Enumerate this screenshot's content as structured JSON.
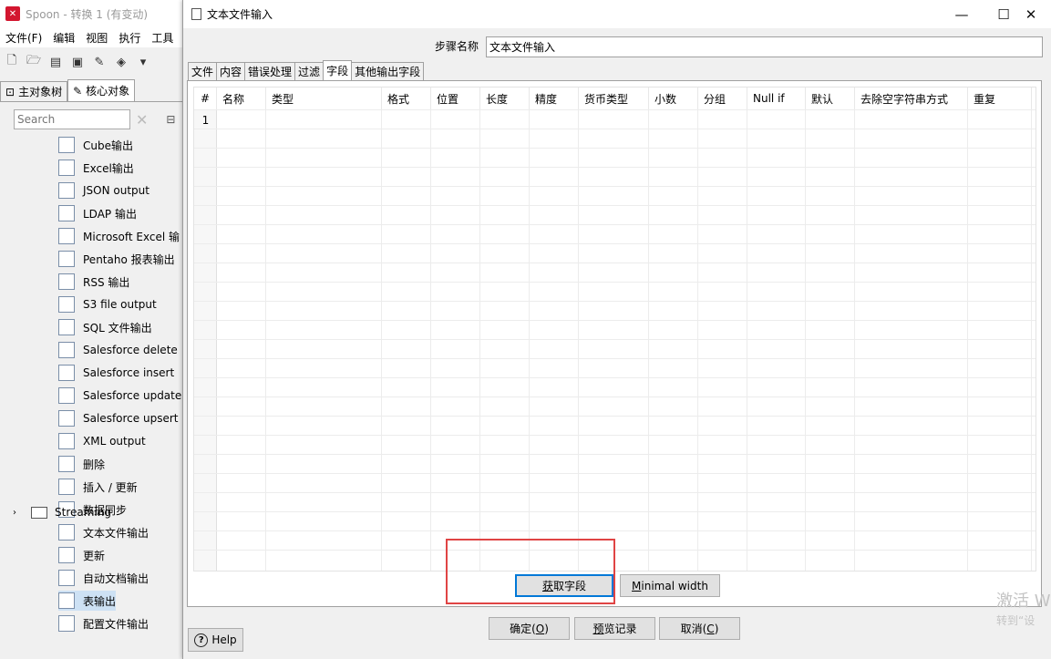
{
  "spoon": {
    "title": "Spoon - 转换 1 (有变动)",
    "menu": [
      "文件(F)",
      "编辑",
      "视图",
      "执行",
      "工具"
    ],
    "tabs": [
      {
        "label": "主对象树",
        "icon": "object-tree-icon"
      },
      {
        "label": "核心对象",
        "icon": "pencil-icon"
      }
    ],
    "search_placeholder": "Search",
    "tree_items": [
      {
        "label": "Cube输出",
        "icon": "cube-output-icon"
      },
      {
        "label": "Excel输出",
        "icon": "excel-icon"
      },
      {
        "label": "JSON output",
        "icon": "json-icon"
      },
      {
        "label": "LDAP 输出",
        "icon": "ldap-icon"
      },
      {
        "label": "Microsoft Excel 输",
        "icon": "excel-icon"
      },
      {
        "label": "Pentaho 报表输出",
        "icon": "report-icon"
      },
      {
        "label": "RSS 输出",
        "icon": "rss-icon"
      },
      {
        "label": "S3 file output",
        "icon": "s3-icon"
      },
      {
        "label": "SQL 文件输出",
        "icon": "sql-icon"
      },
      {
        "label": "Salesforce delete",
        "icon": "salesforce-delete-icon"
      },
      {
        "label": "Salesforce insert",
        "icon": "salesforce-insert-icon"
      },
      {
        "label": "Salesforce update",
        "icon": "salesforce-update-icon"
      },
      {
        "label": "Salesforce upsert",
        "icon": "salesforce-upsert-icon"
      },
      {
        "label": "XML output",
        "icon": "xml-icon"
      },
      {
        "label": "删除",
        "icon": "delete-db-icon"
      },
      {
        "label": "插入 / 更新",
        "icon": "insert-update-icon"
      },
      {
        "label": "数据同步",
        "icon": "sync-icon"
      },
      {
        "label": "文本文件输出",
        "icon": "text-file-icon"
      },
      {
        "label": "更新",
        "icon": "update-icon"
      },
      {
        "label": "自动文档输出",
        "icon": "auto-doc-icon"
      },
      {
        "label": "表输出",
        "icon": "table-output-icon",
        "selected": true
      },
      {
        "label": "配置文件输出",
        "icon": "config-file-icon"
      }
    ],
    "streaming_label": "Streaming"
  },
  "dialog": {
    "title": "文本文件输入",
    "step_name_label": "步骤名称",
    "step_name_value": "文本文件输入",
    "tabs": [
      "文件",
      "内容",
      "错误处理",
      "过滤",
      "字段",
      "其他输出字段"
    ],
    "active_tab": "字段",
    "columns": [
      "#",
      "名称",
      "类型",
      "格式",
      "位置",
      "长度",
      "精度",
      "货币类型",
      "小数",
      "分组",
      "Null if",
      "默认",
      "去除空字符串方式",
      "重复"
    ],
    "rows": [
      "1"
    ],
    "get_fields_prefix": "",
    "get_fields_key": "获",
    "get_fields_rest": "取字段",
    "minimal_width_key": "M",
    "minimal_width_rest": "inimal width",
    "ok_label": "确定(",
    "ok_key": "O",
    "ok_suffix": ")",
    "preview_key": "预",
    "preview_rest": "览记录",
    "cancel_label": "取消(",
    "cancel_key": "C",
    "cancel_suffix": ")",
    "help_label": "Help"
  },
  "watermark": {
    "line1": "激活 W",
    "line2": "转到“设"
  }
}
